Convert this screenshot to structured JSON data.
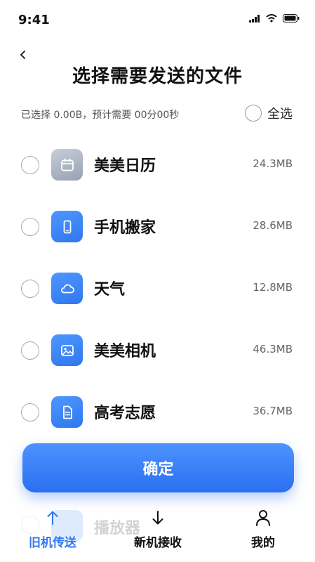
{
  "status_bar": {
    "time": "9:41"
  },
  "header": {
    "title": "选择需要发送的文件"
  },
  "summary": {
    "text": "已选择 0.00B，预计需要 00分00秒",
    "select_all_label": "全选"
  },
  "files": [
    {
      "name": "美美日历",
      "size": "24.3MB",
      "icon": "calendar-icon",
      "color": "gray"
    },
    {
      "name": "手机搬家",
      "size": "28.6MB",
      "icon": "phone-icon",
      "color": "blue"
    },
    {
      "name": "天气",
      "size": "12.8MB",
      "icon": "cloud-icon",
      "color": "blue"
    },
    {
      "name": "美美相机",
      "size": "46.3MB",
      "icon": "image-icon",
      "color": "blue"
    },
    {
      "name": "高考志愿",
      "size": "36.7MB",
      "icon": "document-icon",
      "color": "blue"
    },
    {
      "name": "播放器",
      "size": "",
      "icon": "play-icon",
      "color": "blue"
    }
  ],
  "confirm_label": "确定",
  "tabs": [
    {
      "label": "旧机传送",
      "icon": "arrow-up-icon",
      "active": true
    },
    {
      "label": "新机接收",
      "icon": "arrow-down-icon",
      "active": false
    },
    {
      "label": "我的",
      "icon": "user-icon",
      "active": false
    }
  ],
  "colors": {
    "accent": "#2f77ee",
    "icon_gray": "#a9b1bf"
  }
}
